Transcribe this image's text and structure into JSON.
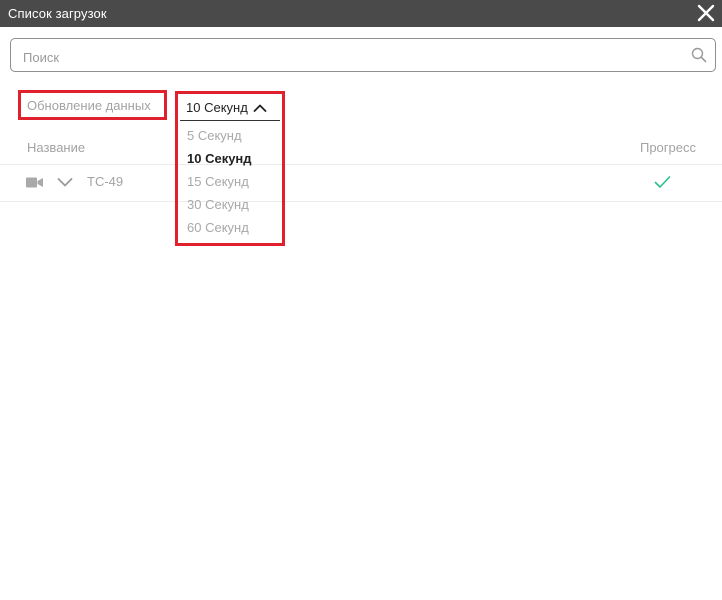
{
  "window": {
    "title": "Список загрузок"
  },
  "search": {
    "placeholder": "Поиск",
    "value": ""
  },
  "refresh": {
    "label": "Обновление данных",
    "selected": "10 Секунд",
    "options": [
      "5 Секунд",
      "10 Секунд",
      "15 Секунд",
      "30 Секунд",
      "60 Секунд"
    ]
  },
  "table": {
    "columns": {
      "name": "Название",
      "progress": "Прогресс"
    },
    "rows": [
      {
        "name": "TC-49",
        "status": "complete"
      }
    ]
  },
  "colors": {
    "titlebar": "#4a4a4a",
    "highlight": "#e0202c",
    "check": "#2bbf8a",
    "muted": "#a3a3a3"
  },
  "icons": {
    "close": "close-icon",
    "search": "search-icon",
    "dropdown": "chevron-up-icon",
    "row_type": "camera-icon",
    "row_expand": "chevron-down-icon",
    "row_status": "checkmark-icon"
  }
}
